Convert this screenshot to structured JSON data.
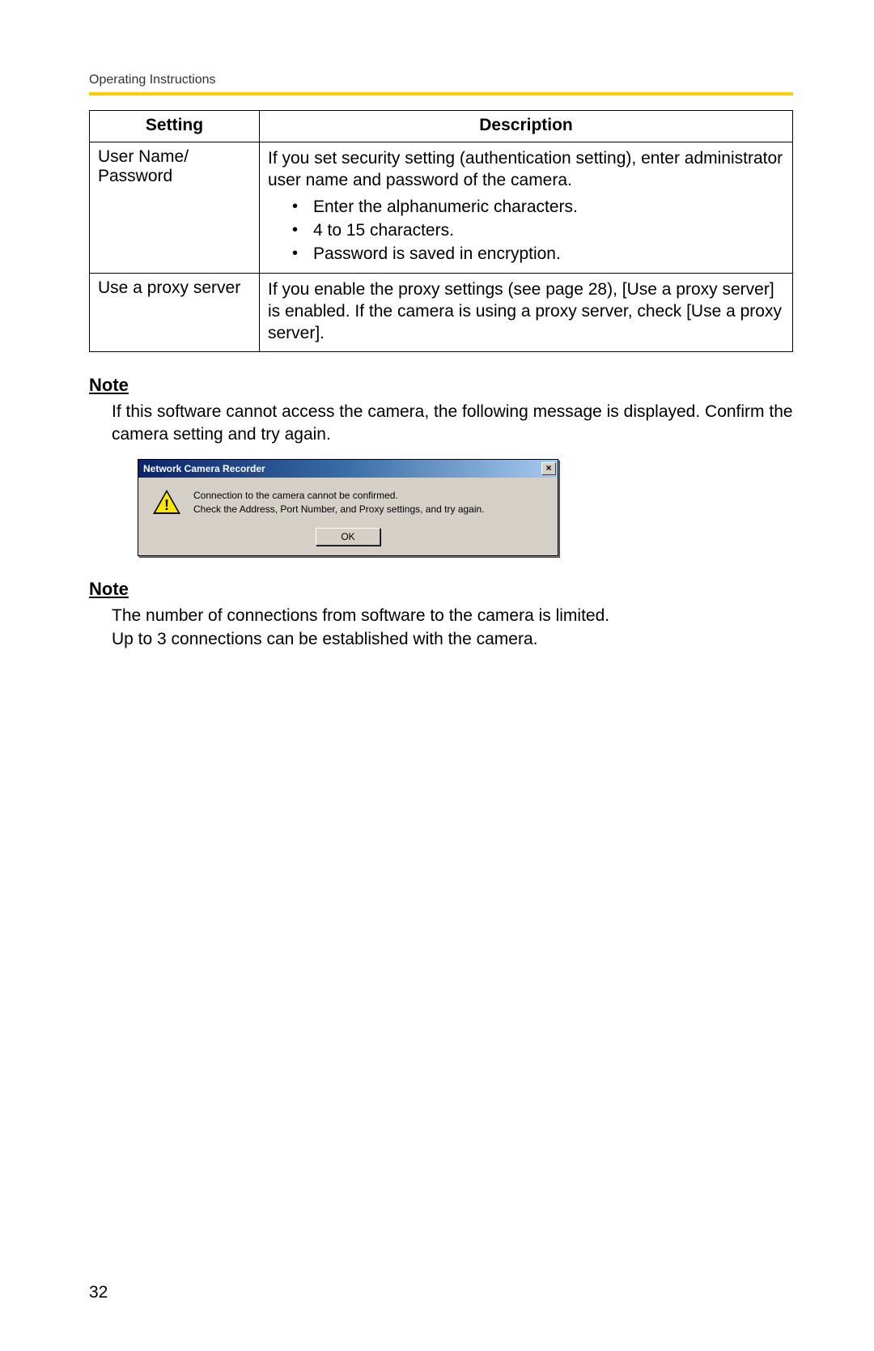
{
  "running_header": "Operating Instructions",
  "page_number": "32",
  "table": {
    "headers": {
      "setting": "Setting",
      "description": "Description"
    },
    "rows": [
      {
        "setting": "User Name/\nPassword",
        "intro": "If you set security setting (authentication setting), enter administrator user name and password of the camera.",
        "bullets": [
          "Enter the alphanumeric characters.",
          "4 to 15 characters.",
          "Password is saved in encryption."
        ]
      },
      {
        "setting": "Use a proxy server",
        "intro": "If you enable the proxy settings (see page 28), [Use a proxy server] is enabled. If the camera is using a proxy server, check [Use a proxy server].",
        "bullets": []
      }
    ]
  },
  "note1": {
    "heading": "Note",
    "body": "If this software cannot access the camera, the following message is displayed. Confirm the camera setting and try again."
  },
  "dialog": {
    "title": "Network Camera Recorder",
    "line1": "Connection to the camera cannot be confirmed.",
    "line2": "Check the Address, Port Number, and Proxy settings, and try again.",
    "ok": "OK",
    "close_glyph": "×"
  },
  "note2": {
    "heading": "Note",
    "body_line1": "The number of connections from software to the camera is limited.",
    "body_line2": "Up to 3 connections can be established with the camera."
  }
}
